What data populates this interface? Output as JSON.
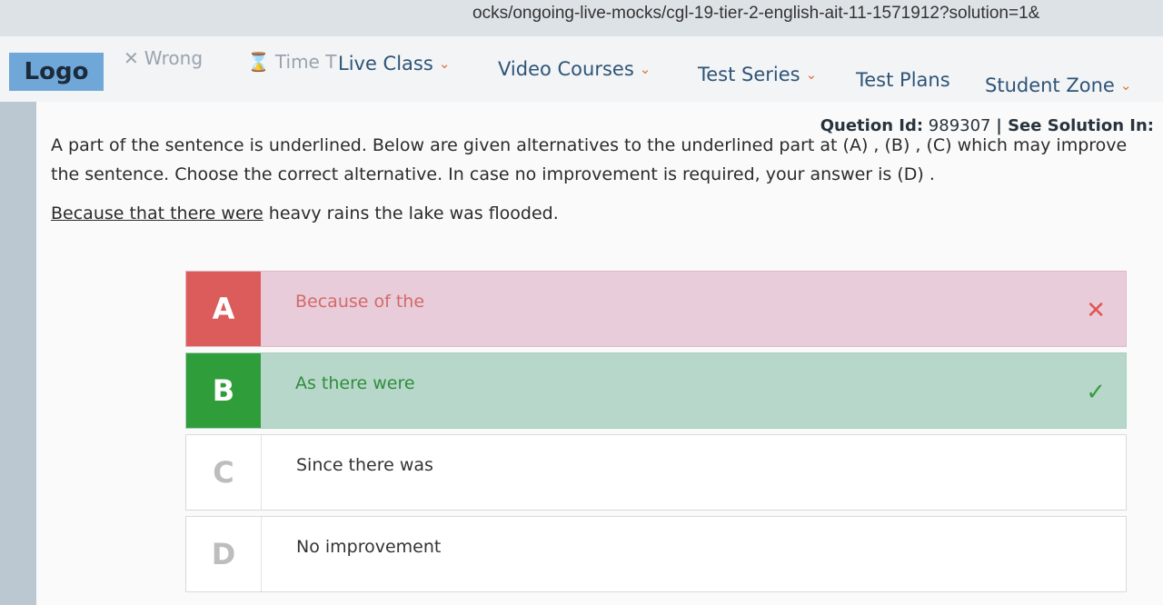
{
  "browser": {
    "url": "ocks/ongoing-live-mocks/cgl-19-tier-2-english-ait-11-1571912?solution=1&"
  },
  "header": {
    "logo_text": "Logo",
    "wrong_label": "Wrong",
    "time_label": "Time T",
    "nav_items": [
      {
        "label": "Live Class"
      },
      {
        "label": "Video Courses"
      },
      {
        "label": "Test Series"
      },
      {
        "label": "Test Plans"
      },
      {
        "label": "Student Zone"
      }
    ]
  },
  "question": {
    "id_label": "Quetion Id:",
    "id_value": "989307",
    "see_solution": "See Solution In:",
    "text": "A part of the sentence is underlined. Below are given alternatives to the underlined part at (A) , (B) , (C) which may improve the sentence. Choose the correct alternative. In case no improvement is required, your answer is (D) .",
    "sentence_underlined": "Because that there were",
    "sentence_rest": " heavy rains the lake was flooded."
  },
  "options": [
    {
      "letter": "A",
      "text": "Because of the",
      "status": "wrong",
      "mark": "✕"
    },
    {
      "letter": "B",
      "text": "As there were",
      "status": "correct",
      "mark": "✓"
    },
    {
      "letter": "C",
      "text": "Since there was",
      "status": "none",
      "mark": ""
    },
    {
      "letter": "D",
      "text": "No improvement",
      "status": "none",
      "mark": ""
    }
  ],
  "colors": {
    "wrong": "#dc5b5b",
    "correct": "#2f9e3a",
    "nav_text": "#2f5477",
    "chevron": "#e2713d"
  }
}
